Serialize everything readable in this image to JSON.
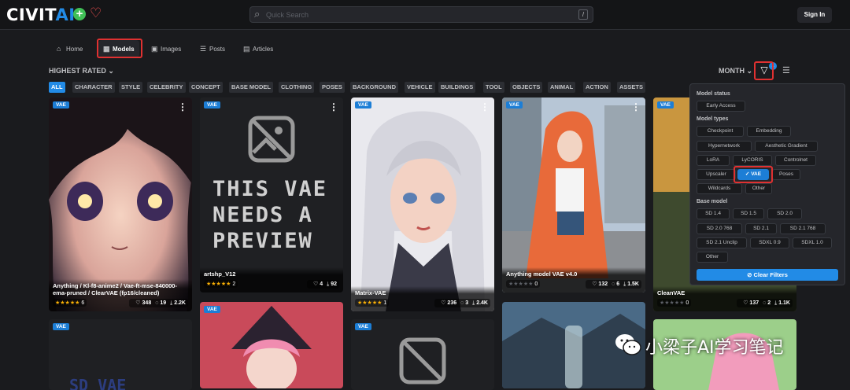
{
  "header": {
    "logo_main": "CIVIT",
    "logo_ai": "AI",
    "search_placeholder": "Quick Search",
    "search_shortcut": "/",
    "signin_label": "Sign In"
  },
  "nav": {
    "items": [
      {
        "label": "Home",
        "icon": "home-icon"
      },
      {
        "label": "Models",
        "icon": "grid-icon",
        "active": true
      },
      {
        "label": "Images",
        "icon": "image-icon"
      },
      {
        "label": "Posts",
        "icon": "layout-icon"
      },
      {
        "label": "Articles",
        "icon": "file-icon"
      }
    ]
  },
  "toolbar": {
    "sort_label": "HIGHEST RATED",
    "period_label": "MONTH",
    "filter_count": "1"
  },
  "tags": [
    "ALL",
    "CHARACTER",
    "STYLE",
    "CELEBRITY",
    "CONCEPT",
    "BASE MODEL",
    "CLOTHING",
    "POSES",
    "BACKGROUND",
    "VEHICLE",
    "BUILDINGS",
    "TOOL",
    "OBJECTS",
    "ANIMAL",
    "ACTION",
    "ASSETS"
  ],
  "cards": [
    {
      "badge": "VAE",
      "title": "Anything / Kl-f8-anime2 / Vae-ft-mse-840000-ema-pruned / ClearVAE (fp16/cleaned)",
      "rating": 5,
      "rating_count": "6",
      "likes": "348",
      "comments": "19",
      "downloads": "2.2K"
    },
    {
      "badge": "VAE",
      "title": "artshp_V12",
      "rating": 5,
      "rating_count": "2",
      "likes": "4",
      "comments": "",
      "downloads": "92",
      "image_text": "THIS VAE NEEDS A PREVIEW"
    },
    {
      "badge": "VAE",
      "title": "Matrix-VAE",
      "rating": 5,
      "rating_count": "1",
      "likes": "236",
      "comments": "3",
      "downloads": "2.4K"
    },
    {
      "badge": "VAE",
      "title": "Anything model VAE v4.0",
      "rating": 0,
      "rating_count": "0",
      "likes": "132",
      "comments": "6",
      "downloads": "1.5K"
    },
    {
      "badge": "VAE",
      "title": "CleanVAE",
      "rating": 0,
      "rating_count": "0",
      "likes": "137",
      "comments": "2",
      "downloads": "1.1K"
    },
    {
      "badge": "VAE",
      "title": "",
      "image_text": "SD VAE"
    },
    {
      "badge": "VAE",
      "title": ""
    },
    {
      "badge": "VAE",
      "title": ""
    },
    {
      "badge": "",
      "title": ""
    },
    {
      "badge": "",
      "title": ""
    }
  ],
  "filters": {
    "status_title": "Model status",
    "status_options": [
      "Early Access"
    ],
    "types_title": "Model types",
    "types_options": [
      "Checkpoint",
      "Embedding",
      "Hypernetwork",
      "Aesthetic Gradient",
      "LoRA",
      "LyCORIS",
      "Controlnet",
      "Upscaler",
      "VAE",
      "Poses",
      "Wildcards",
      "Other"
    ],
    "selected_type": "VAE",
    "base_title": "Base model",
    "base_options": [
      "SD 1.4",
      "SD 1.5",
      "SD 2.0",
      "SD 2.0 768",
      "SD 2.1",
      "SD 2.1 768",
      "SD 2.1 Unclip",
      "SDXL 0.9",
      "SDXL 1.0",
      "Other"
    ],
    "clear_label": "Clear Filters"
  },
  "watermark": {
    "text": "小梁子AI学习笔记"
  },
  "colors": {
    "accent": "#228be6",
    "highlight_box": "#e03131",
    "background": "#1a1b1e"
  }
}
